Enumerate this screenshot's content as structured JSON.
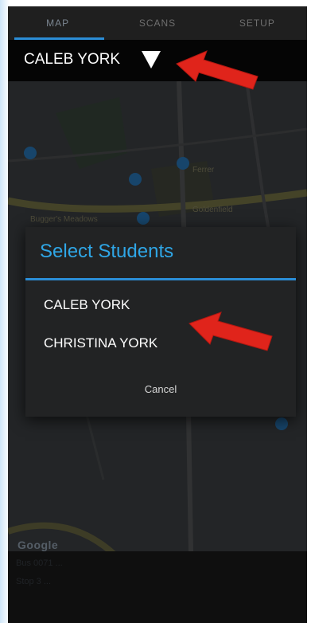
{
  "tabs": [
    {
      "label": "MAP",
      "active": true
    },
    {
      "label": "SCANS",
      "active": false
    },
    {
      "label": "SETUP",
      "active": false
    }
  ],
  "student_bar": {
    "selected_student": "CALEB YORK",
    "dropdown_icon": "triangle-down-icon"
  },
  "map": {
    "labels": [
      "Bugger's Meadows",
      "Ferrer",
      "Goldenfield",
      "Google"
    ],
    "pin_icon": "map-pin-icon"
  },
  "info": {
    "line1": "Bus 0071 ...",
    "line2": "Stop 3 ..."
  },
  "dialog": {
    "title": "Select Students",
    "options": [
      "CALEB YORK",
      "CHRISTINA YORK"
    ],
    "cancel_label": "Cancel"
  },
  "colors": {
    "accent": "#2b8dd6",
    "title": "#2fa6e6",
    "arrow": "#e0241b"
  }
}
